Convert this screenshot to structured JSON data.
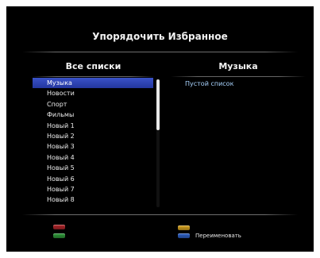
{
  "title": "Упорядочить Избранное",
  "left_panel": {
    "header": "Все списки",
    "items": [
      {
        "label": "Музыка",
        "selected": true
      },
      {
        "label": "Новости",
        "selected": false
      },
      {
        "label": "Спорт",
        "selected": false
      },
      {
        "label": "Фильмы",
        "selected": false
      },
      {
        "label": "Новый 1",
        "selected": false
      },
      {
        "label": "Новый 2",
        "selected": false
      },
      {
        "label": "Новый 3",
        "selected": false
      },
      {
        "label": "Новый 4",
        "selected": false
      },
      {
        "label": "Новый 5",
        "selected": false
      },
      {
        "label": "Новый 6",
        "selected": false
      },
      {
        "label": "Новый 7",
        "selected": false
      },
      {
        "label": "Новый 8",
        "selected": false
      }
    ]
  },
  "right_panel": {
    "header": "Музыка",
    "empty_text": "Пустой список"
  },
  "footer": {
    "keys": [
      {
        "name": "red-key",
        "color": "#b0262a",
        "label": ""
      },
      {
        "name": "green-key",
        "color": "#2f9a3a",
        "label": ""
      },
      {
        "name": "yellow-key",
        "color": "#d9a520",
        "label": ""
      },
      {
        "name": "blue-key",
        "color": "#2f62c8",
        "label": "Переименовать"
      }
    ]
  },
  "colors": {
    "screen_bg": "#000000",
    "selection": "#2f47b8",
    "accent_text": "#a9d4ff"
  }
}
